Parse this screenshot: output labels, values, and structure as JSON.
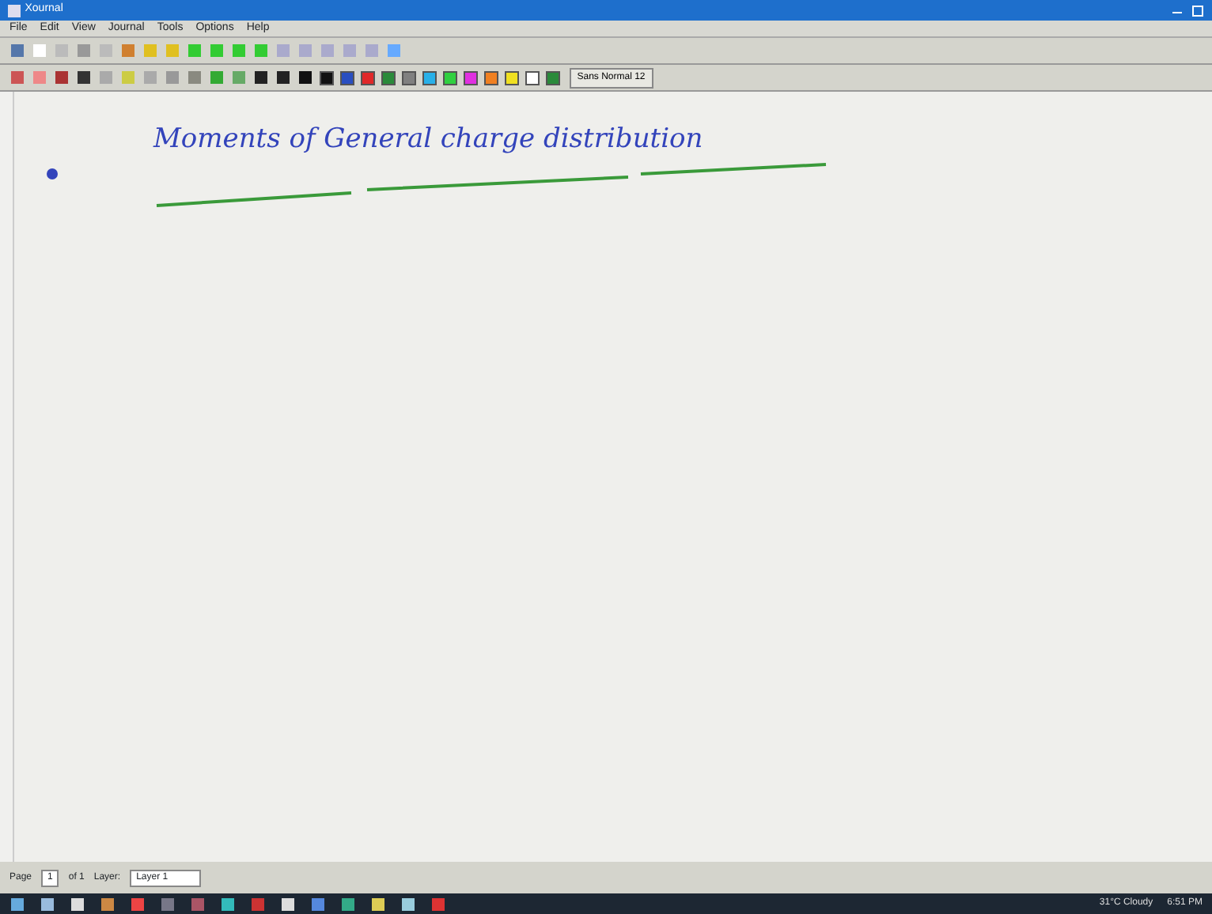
{
  "window": {
    "title": "Xournal"
  },
  "menu": [
    "File",
    "Edit",
    "View",
    "Journal",
    "Tools",
    "Options",
    "Help"
  ],
  "pen_colors": [
    {
      "color": "#111111"
    },
    {
      "color": "#2a4fc0"
    },
    {
      "color": "#e02828"
    },
    {
      "color": "#2a8a3a"
    },
    {
      "color": "#808080"
    },
    {
      "color": "#28b0e8"
    },
    {
      "color": "#30d040"
    },
    {
      "color": "#e030e0"
    },
    {
      "color": "#f08020"
    },
    {
      "color": "#f0e020"
    },
    {
      "color": "#ffffff"
    },
    {
      "color": "#2a8a3a"
    }
  ],
  "font_button": "Sans Normal  12",
  "page": {
    "heading": "Moments of General charge distribution"
  },
  "status_bar": {
    "page_label": "Page",
    "page_number": "1",
    "page_total": "of 1",
    "layer_label": "Layer:",
    "layer_value": "Layer 1"
  },
  "taskbar": {
    "weather": "31°C Cloudy",
    "time": "6:51 PM"
  }
}
